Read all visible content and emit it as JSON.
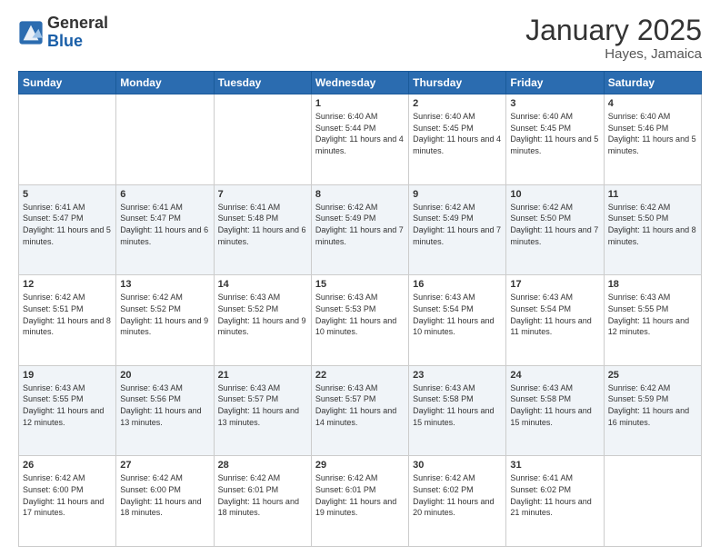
{
  "header": {
    "logo_text_general": "General",
    "logo_text_blue": "Blue",
    "month_title": "January 2025",
    "location": "Hayes, Jamaica"
  },
  "days_of_week": [
    "Sunday",
    "Monday",
    "Tuesday",
    "Wednesday",
    "Thursday",
    "Friday",
    "Saturday"
  ],
  "weeks": [
    [
      {
        "day": "",
        "info": ""
      },
      {
        "day": "",
        "info": ""
      },
      {
        "day": "",
        "info": ""
      },
      {
        "day": "1",
        "info": "Sunrise: 6:40 AM\nSunset: 5:44 PM\nDaylight: 11 hours\nand 4 minutes."
      },
      {
        "day": "2",
        "info": "Sunrise: 6:40 AM\nSunset: 5:45 PM\nDaylight: 11 hours\nand 4 minutes."
      },
      {
        "day": "3",
        "info": "Sunrise: 6:40 AM\nSunset: 5:45 PM\nDaylight: 11 hours\nand 5 minutes."
      },
      {
        "day": "4",
        "info": "Sunrise: 6:40 AM\nSunset: 5:46 PM\nDaylight: 11 hours\nand 5 minutes."
      }
    ],
    [
      {
        "day": "5",
        "info": "Sunrise: 6:41 AM\nSunset: 5:47 PM\nDaylight: 11 hours\nand 5 minutes."
      },
      {
        "day": "6",
        "info": "Sunrise: 6:41 AM\nSunset: 5:47 PM\nDaylight: 11 hours\nand 6 minutes."
      },
      {
        "day": "7",
        "info": "Sunrise: 6:41 AM\nSunset: 5:48 PM\nDaylight: 11 hours\nand 6 minutes."
      },
      {
        "day": "8",
        "info": "Sunrise: 6:42 AM\nSunset: 5:49 PM\nDaylight: 11 hours\nand 7 minutes."
      },
      {
        "day": "9",
        "info": "Sunrise: 6:42 AM\nSunset: 5:49 PM\nDaylight: 11 hours\nand 7 minutes."
      },
      {
        "day": "10",
        "info": "Sunrise: 6:42 AM\nSunset: 5:50 PM\nDaylight: 11 hours\nand 7 minutes."
      },
      {
        "day": "11",
        "info": "Sunrise: 6:42 AM\nSunset: 5:50 PM\nDaylight: 11 hours\nand 8 minutes."
      }
    ],
    [
      {
        "day": "12",
        "info": "Sunrise: 6:42 AM\nSunset: 5:51 PM\nDaylight: 11 hours\nand 8 minutes."
      },
      {
        "day": "13",
        "info": "Sunrise: 6:42 AM\nSunset: 5:52 PM\nDaylight: 11 hours\nand 9 minutes."
      },
      {
        "day": "14",
        "info": "Sunrise: 6:43 AM\nSunset: 5:52 PM\nDaylight: 11 hours\nand 9 minutes."
      },
      {
        "day": "15",
        "info": "Sunrise: 6:43 AM\nSunset: 5:53 PM\nDaylight: 11 hours\nand 10 minutes."
      },
      {
        "day": "16",
        "info": "Sunrise: 6:43 AM\nSunset: 5:54 PM\nDaylight: 11 hours\nand 10 minutes."
      },
      {
        "day": "17",
        "info": "Sunrise: 6:43 AM\nSunset: 5:54 PM\nDaylight: 11 hours\nand 11 minutes."
      },
      {
        "day": "18",
        "info": "Sunrise: 6:43 AM\nSunset: 5:55 PM\nDaylight: 11 hours\nand 12 minutes."
      }
    ],
    [
      {
        "day": "19",
        "info": "Sunrise: 6:43 AM\nSunset: 5:55 PM\nDaylight: 11 hours\nand 12 minutes."
      },
      {
        "day": "20",
        "info": "Sunrise: 6:43 AM\nSunset: 5:56 PM\nDaylight: 11 hours\nand 13 minutes."
      },
      {
        "day": "21",
        "info": "Sunrise: 6:43 AM\nSunset: 5:57 PM\nDaylight: 11 hours\nand 13 minutes."
      },
      {
        "day": "22",
        "info": "Sunrise: 6:43 AM\nSunset: 5:57 PM\nDaylight: 11 hours\nand 14 minutes."
      },
      {
        "day": "23",
        "info": "Sunrise: 6:43 AM\nSunset: 5:58 PM\nDaylight: 11 hours\nand 15 minutes."
      },
      {
        "day": "24",
        "info": "Sunrise: 6:43 AM\nSunset: 5:58 PM\nDaylight: 11 hours\nand 15 minutes."
      },
      {
        "day": "25",
        "info": "Sunrise: 6:42 AM\nSunset: 5:59 PM\nDaylight: 11 hours\nand 16 minutes."
      }
    ],
    [
      {
        "day": "26",
        "info": "Sunrise: 6:42 AM\nSunset: 6:00 PM\nDaylight: 11 hours\nand 17 minutes."
      },
      {
        "day": "27",
        "info": "Sunrise: 6:42 AM\nSunset: 6:00 PM\nDaylight: 11 hours\nand 18 minutes."
      },
      {
        "day": "28",
        "info": "Sunrise: 6:42 AM\nSunset: 6:01 PM\nDaylight: 11 hours\nand 18 minutes."
      },
      {
        "day": "29",
        "info": "Sunrise: 6:42 AM\nSunset: 6:01 PM\nDaylight: 11 hours\nand 19 minutes."
      },
      {
        "day": "30",
        "info": "Sunrise: 6:42 AM\nSunset: 6:02 PM\nDaylight: 11 hours\nand 20 minutes."
      },
      {
        "day": "31",
        "info": "Sunrise: 6:41 AM\nSunset: 6:02 PM\nDaylight: 11 hours\nand 21 minutes."
      },
      {
        "day": "",
        "info": ""
      }
    ]
  ]
}
